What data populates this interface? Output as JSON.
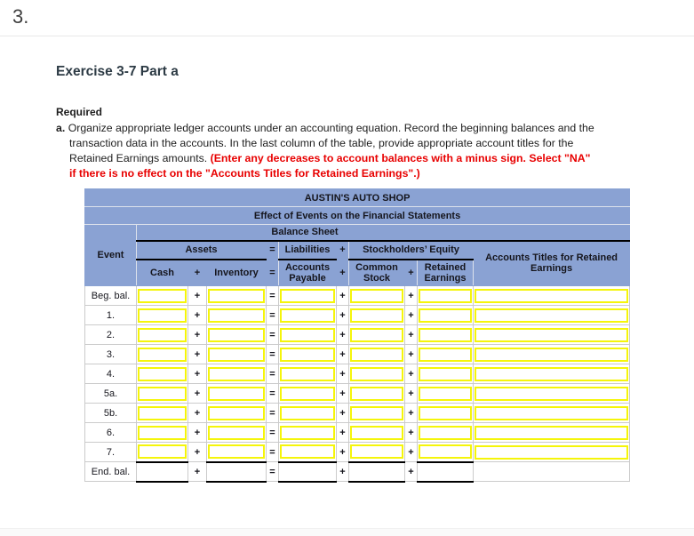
{
  "page": {
    "question_number": "3."
  },
  "exercise": {
    "title": "Exercise 3-7 Part a"
  },
  "required": {
    "heading": "Required",
    "item_letter": "a.",
    "instruction_black": "Organize appropriate ledger accounts under an accounting equation. Record the beginning balances and the transaction data in the accounts. In the last column of the table, provide appropriate account titles for the Retained Earnings amounts. ",
    "instruction_red": "(Enter any decreases to account balances with a minus sign. Select \"NA\" if there is no effect on the \"Accounts Titles for Retained Earnings\".)"
  },
  "table": {
    "title": "AUSTIN'S AUTO SHOP",
    "subtitle": "Effect of Events on the Financial Statements",
    "section_header": "Balance Sheet",
    "event_header": "Event",
    "group_headers": {
      "assets": "Assets",
      "liabilities": "Liabilities",
      "equity": "Stockholders’ Equity",
      "accounts_titles": "Accounts Titles for Retained Earnings"
    },
    "column_headers": {
      "cash": "Cash",
      "inventory": "Inventory",
      "accounts_payable": "Accounts Payable",
      "common_stock": "Common Stock",
      "retained_earnings": "Retained Earnings"
    },
    "operators": {
      "plus": "+",
      "equals": "="
    },
    "rows": [
      {
        "label": "Beg. bal.",
        "cash": "",
        "inventory": "",
        "accounts_payable": "",
        "common_stock": "",
        "retained_earnings": "",
        "accounts_titles": ""
      },
      {
        "label": "1.",
        "cash": "",
        "inventory": "",
        "accounts_payable": "",
        "common_stock": "",
        "retained_earnings": "",
        "accounts_titles": ""
      },
      {
        "label": "2.",
        "cash": "",
        "inventory": "",
        "accounts_payable": "",
        "common_stock": "",
        "retained_earnings": "",
        "accounts_titles": ""
      },
      {
        "label": "3.",
        "cash": "",
        "inventory": "",
        "accounts_payable": "",
        "common_stock": "",
        "retained_earnings": "",
        "accounts_titles": ""
      },
      {
        "label": "4.",
        "cash": "",
        "inventory": "",
        "accounts_payable": "",
        "common_stock": "",
        "retained_earnings": "",
        "accounts_titles": ""
      },
      {
        "label": "5a.",
        "cash": "",
        "inventory": "",
        "accounts_payable": "",
        "common_stock": "",
        "retained_earnings": "",
        "accounts_titles": ""
      },
      {
        "label": "5b.",
        "cash": "",
        "inventory": "",
        "accounts_payable": "",
        "common_stock": "",
        "retained_earnings": "",
        "accounts_titles": ""
      },
      {
        "label": "6.",
        "cash": "",
        "inventory": "",
        "accounts_payable": "",
        "common_stock": "",
        "retained_earnings": "",
        "accounts_titles": ""
      },
      {
        "label": "7.",
        "cash": "",
        "inventory": "",
        "accounts_payable": "",
        "common_stock": "",
        "retained_earnings": "",
        "accounts_titles": ""
      },
      {
        "label": "End. bal.",
        "cash": "",
        "inventory": "",
        "accounts_payable": "",
        "common_stock": "",
        "retained_earnings": "",
        "accounts_titles": ""
      }
    ],
    "colors": {
      "header_bg": "#8aa2d3",
      "input_border": "#f5f50a",
      "instruction_red": "#e80000"
    }
  }
}
